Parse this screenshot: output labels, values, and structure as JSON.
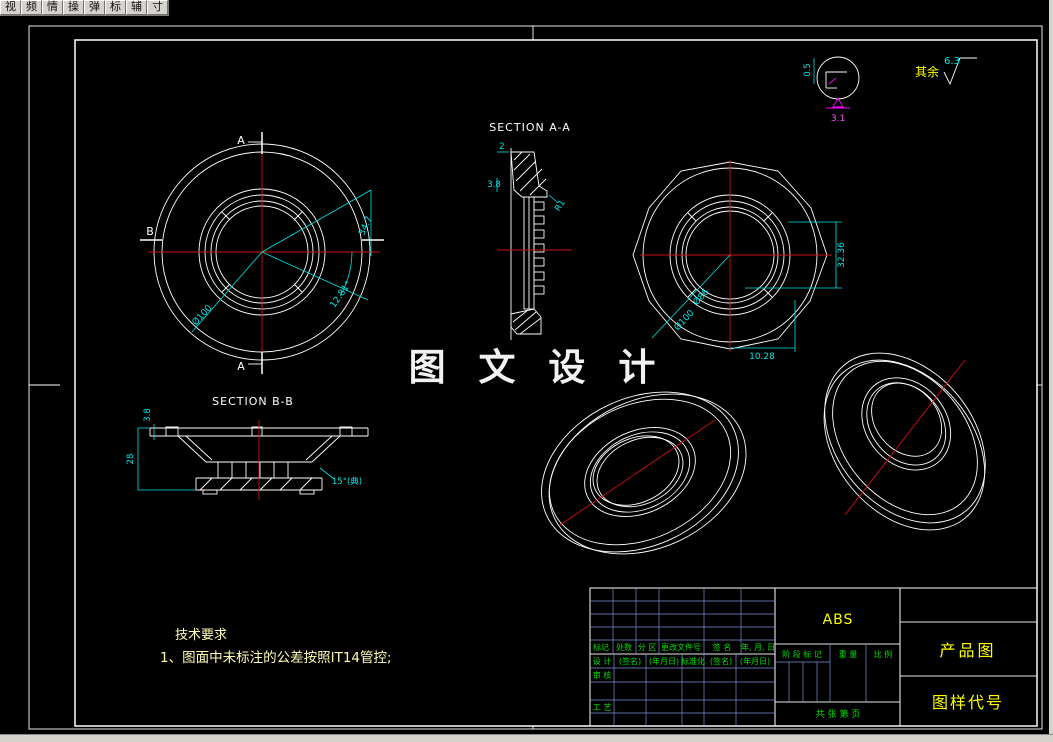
{
  "menu": {
    "items": [
      "视",
      "频",
      "情",
      "操",
      "弹",
      "标",
      "辅",
      "寸"
    ]
  },
  "watermark": {
    "text": "图 文 设 计"
  },
  "views": {
    "section_a_label": "SECTION A-A",
    "section_b_label": "SECTION B-B",
    "marker_a": "A",
    "marker_b": "B"
  },
  "dims": {
    "front_dia": "Ø100",
    "front_len": "34.7",
    "front_angle": "12.81°",
    "sa_top": "2",
    "sa_wall": "3.8",
    "sa_r1": "R1",
    "rv_height": "32.36",
    "rv_width": "10.28",
    "rv_d86": "Ø86",
    "rv_d100": "Ø100",
    "sb_wall": "3.8",
    "sb_height": "28",
    "sb_angle": "15°(典)"
  },
  "finish": {
    "rest_label": "其余",
    "rest_value": "6.3",
    "detail_offset": "0.5",
    "detail_value": "3.1"
  },
  "tech": {
    "title": "技术要求",
    "line1": "1、图面中未标注的公差按照IT14管控;"
  },
  "title_block": {
    "material": "ABS",
    "doc_type": "产品图",
    "doc_code": "图样代号",
    "rev_headers": [
      "标记",
      "处数",
      "分 区",
      "更改文件号",
      "签 名",
      "年, 月, 日"
    ],
    "sig_design": "设 计",
    "sig_name1": "(签名)",
    "sig_date1": "(年月日)",
    "sig_std": "标准化",
    "sig_name2": "(签名)",
    "sig_date2": "(年月日)",
    "sig_audit": "审 核",
    "sig_process": "工 艺",
    "stage_mark": "阶 段 标 记",
    "weight": "重 量",
    "scale": "比 例",
    "sheet_info": "共  张  第  页"
  },
  "colors": {
    "dimension": "#00e5e5",
    "centerline": "#cf1010",
    "outline": "#ffffff",
    "label_green": "#00dd00",
    "label_yellow": "#ffff00",
    "detail_magenta": "#ff50ff",
    "background": "#000000"
  }
}
